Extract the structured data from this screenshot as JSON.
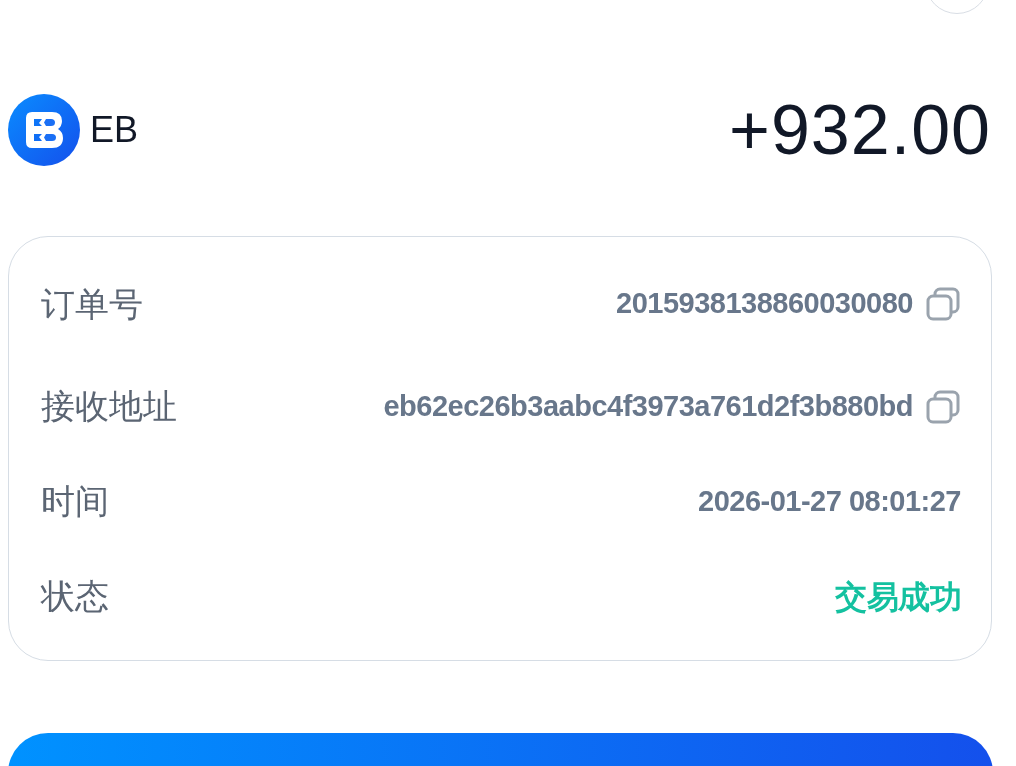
{
  "coin": {
    "symbol": "EB",
    "amount": "+932.00"
  },
  "details": [
    {
      "label": "订单号",
      "value": "2015938138860030080",
      "kind": "text",
      "copyable": true
    },
    {
      "label": "接收地址",
      "value": "eb62ec26b3aabc4f3973a761d2f3b880bd",
      "kind": "text",
      "copyable": true
    },
    {
      "label": "时间",
      "value": "2026-01-27 08:01:27",
      "kind": "text",
      "copyable": false
    },
    {
      "label": "状态",
      "value": "交易成功",
      "kind": "status",
      "copyable": false
    }
  ]
}
